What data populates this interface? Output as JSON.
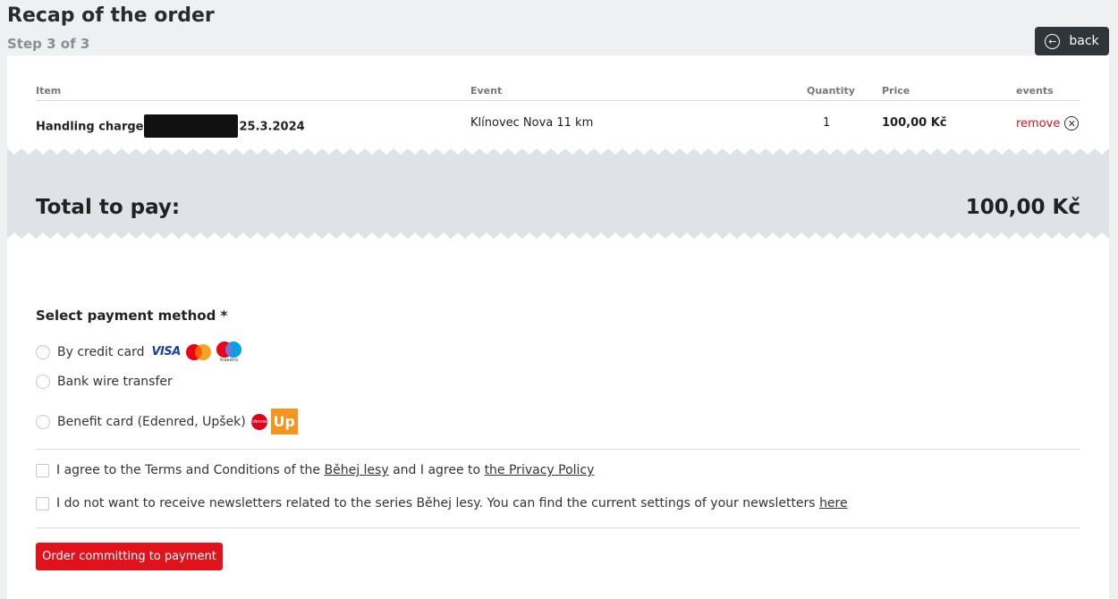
{
  "header": {
    "title": "Recap of the order",
    "step": "Step 3 of 3",
    "back_label": "back"
  },
  "table": {
    "columns": [
      "Item",
      "Event",
      "Quantity",
      "Price",
      "events"
    ],
    "rows": [
      {
        "item_prefix": "Handling charge",
        "item_suffix": "25.3.2024",
        "event": "Klínovec Nova 11 km",
        "quantity": "1",
        "price": "100,00 Kč",
        "action": "remove"
      }
    ]
  },
  "total": {
    "label": "Total to pay:",
    "value": "100,00 Kč"
  },
  "payment": {
    "title": "Select payment method *",
    "options": [
      {
        "label": "By credit card",
        "logos": [
          "visa-logo",
          "mastercard-logo",
          "maestro-logo"
        ]
      },
      {
        "label": "Bank wire transfer",
        "logos": []
      },
      {
        "label": "Benefit card (Edenred, Upšek)",
        "logos": [
          "edenred-logo",
          "up-logo"
        ]
      }
    ],
    "logo_text": {
      "visa": "VISA",
      "maestro": "maestro",
      "edenred": "Edenred",
      "up": "Up"
    }
  },
  "agreements": {
    "terms": {
      "part1": "I agree to the Terms and Conditions of the ",
      "link1": "Běhej lesy",
      "part2": " and I agree to ",
      "link2": "the Privacy Policy"
    },
    "newsletter": {
      "part1": "I do not want to receive newsletters related to the series Běhej lesy. You can find the current settings of your newsletters ",
      "link": "here"
    }
  },
  "submit_label": "Order committing to payment",
  "colors": {
    "accent": "#e1121c",
    "dark_button": "#2f3539",
    "total_band": "#dfe2e6",
    "up_orange": "#f7941d"
  }
}
